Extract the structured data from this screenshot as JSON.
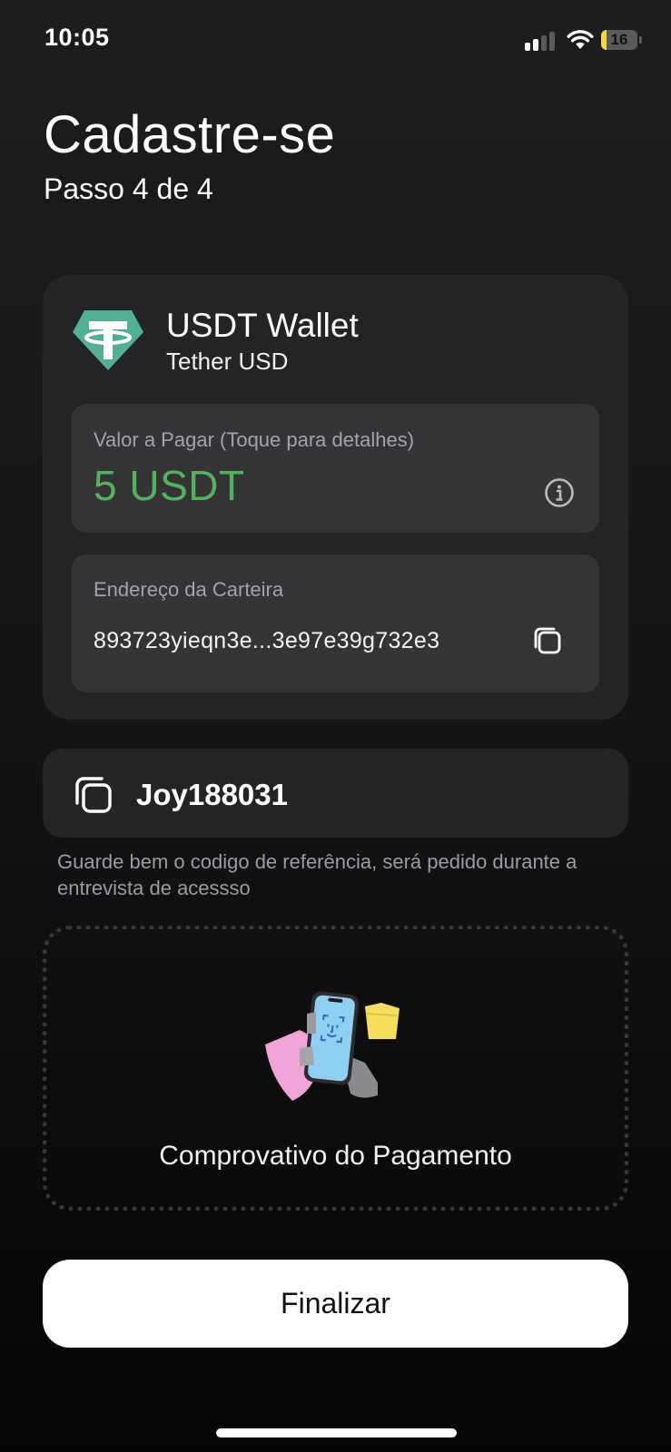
{
  "status_bar": {
    "time": "10:05",
    "battery_level": "16",
    "battery_fraction": 0.16,
    "battery_color": "#f5d53a",
    "signal_bars_active": 2,
    "signal_bars_total": 4,
    "icons": [
      "cellular-signal-icon",
      "wifi-icon",
      "battery-icon"
    ]
  },
  "header": {
    "title": "Cadastre-se",
    "step": "Passo 4 de 4"
  },
  "wallet": {
    "logo_icon": "tether-logo",
    "logo_color": "#50af95",
    "name": "USDT Wallet",
    "network": "Tether USD",
    "amount_label": "Valor a Pagar (Toque para detalhes)",
    "amount_value": "5 USDT",
    "amount_color": "#4fb45a",
    "info_icon": "info-icon",
    "address_label": "Endereço da Carteira",
    "address_value": "893723yieqn3e...3e97e39g732e3",
    "copy_icon": "copy-icon"
  },
  "referral": {
    "copy_icon": "copy-icon",
    "code": "Joy188031",
    "note": "Guarde bem o codigo de referência, será pedido durante a entrevista de acessso"
  },
  "upload": {
    "illustration": "phone-face-id-illustration",
    "label": "Comprovativo do Pagamento"
  },
  "actions": {
    "finalize_label": "Finalizar"
  }
}
